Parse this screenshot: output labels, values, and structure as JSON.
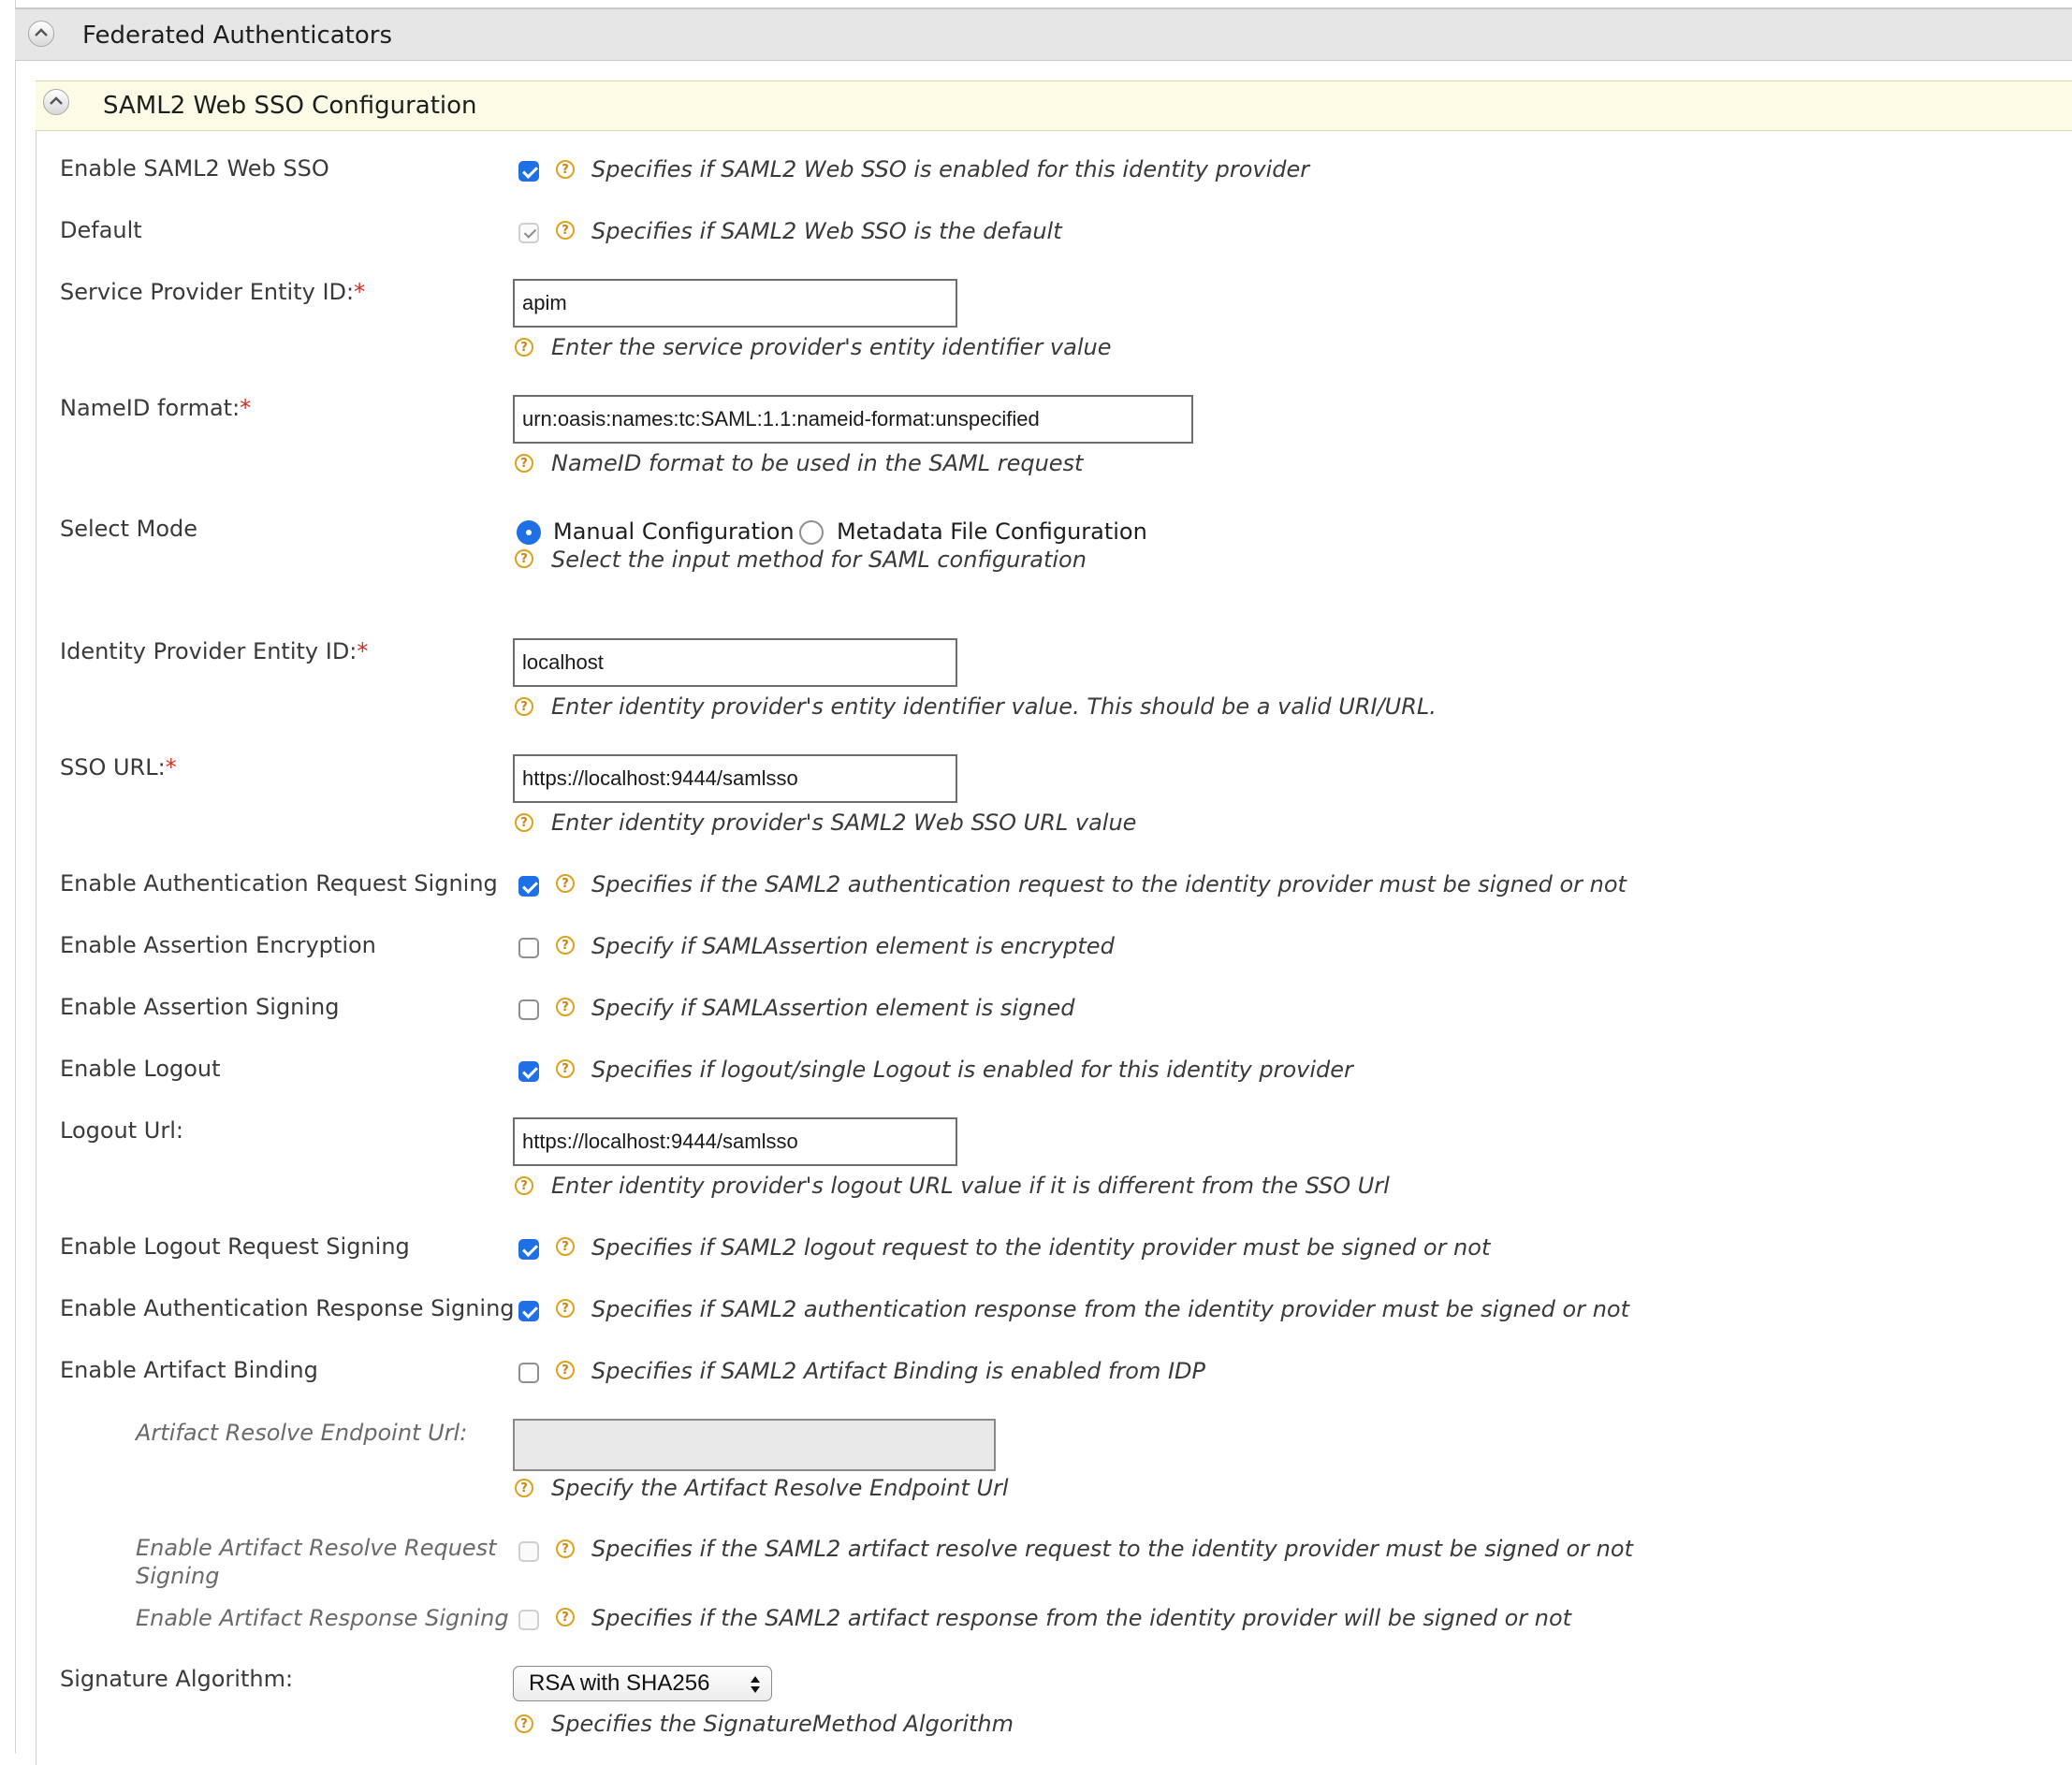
{
  "section": {
    "title": "Federated Authenticators"
  },
  "subsection": {
    "title": "SAML2 Web SSO Configuration"
  },
  "required_mark": "*",
  "rows": {
    "enable_saml2": {
      "label": "Enable SAML2 Web SSO",
      "checked": true,
      "help": "Specifies if SAML2 Web SSO is enabled for this identity provider"
    },
    "default": {
      "label": "Default",
      "checked": true,
      "help": "Specifies if SAML2 Web SSO is the default"
    },
    "sp_entity_id": {
      "label": "Service Provider Entity ID:",
      "value": "apim",
      "help": "Enter the service provider's entity identifier value"
    },
    "nameid_format": {
      "label": "NameID format:",
      "value": "urn:oasis:names:tc:SAML:1.1:nameid-format:unspecified",
      "help": "NameID format to be used in the SAML request"
    },
    "select_mode": {
      "label": "Select Mode",
      "option_manual": "Manual Configuration",
      "option_metadata": "Metadata File Configuration",
      "selected": "Manual Configuration",
      "help": "Select the input method for SAML configuration"
    },
    "idp_entity_id": {
      "label": "Identity Provider Entity ID:",
      "value": "localhost",
      "help": "Enter identity provider's entity identifier value. This should be a valid URI/URL."
    },
    "sso_url": {
      "label": "SSO URL:",
      "value": "https://localhost:9444/samlsso",
      "help": "Enter identity provider's SAML2 Web SSO URL value"
    },
    "authn_request_signing": {
      "label": "Enable Authentication Request Signing",
      "checked": true,
      "help": "Specifies if the SAML2 authentication request to the identity provider must be signed or not"
    },
    "assertion_encryption": {
      "label": "Enable Assertion Encryption",
      "checked": false,
      "help": "Specify if SAMLAssertion element is encrypted"
    },
    "assertion_signing": {
      "label": "Enable Assertion Signing",
      "checked": false,
      "help": "Specify if SAMLAssertion element is signed"
    },
    "logout": {
      "label": "Enable Logout",
      "checked": true,
      "help": "Specifies if logout/single Logout is enabled for this identity provider"
    },
    "logout_url": {
      "label": "Logout Url:",
      "value": "https://localhost:9444/samlsso",
      "help": "Enter identity provider's logout URL value if it is different from the SSO Url"
    },
    "logout_request_signing": {
      "label": "Enable Logout Request Signing",
      "checked": true,
      "help": "Specifies if SAML2 logout request to the identity provider must be signed or not"
    },
    "authn_response_signing": {
      "label": "Enable Authentication Response Signing",
      "checked": true,
      "help": "Specifies if SAML2 authentication response from the identity provider must be signed or not"
    },
    "artifact_binding": {
      "label": "Enable Artifact Binding",
      "checked": false,
      "help": "Specifies if SAML2 Artifact Binding is enabled from IDP"
    },
    "artifact_resolve_url": {
      "label": "Artifact Resolve Endpoint Url:",
      "value": "",
      "help": "Specify the Artifact Resolve Endpoint Url"
    },
    "artifact_resolve_request_signing": {
      "label": "Enable Artifact Resolve Request Signing",
      "checked": false,
      "help": "Specifies if the SAML2 artifact resolve request to the identity provider must be signed or not"
    },
    "artifact_response_signing": {
      "label": "Enable Artifact Response Signing",
      "checked": false,
      "help": "Specifies if the SAML2 artifact response from the identity provider will be signed or not"
    },
    "signature_algorithm": {
      "label": "Signature Algorithm:",
      "value": "RSA with SHA256",
      "help": "Specifies the SignatureMethod Algorithm"
    }
  },
  "help_icon_glyph": "?",
  "colors": {
    "accent": "#1f6fe5",
    "help_icon": "#e0a020",
    "required": "#d03020",
    "subheader_bg": "#fbfbe6",
    "header_bg": "#e6e6e6"
  }
}
